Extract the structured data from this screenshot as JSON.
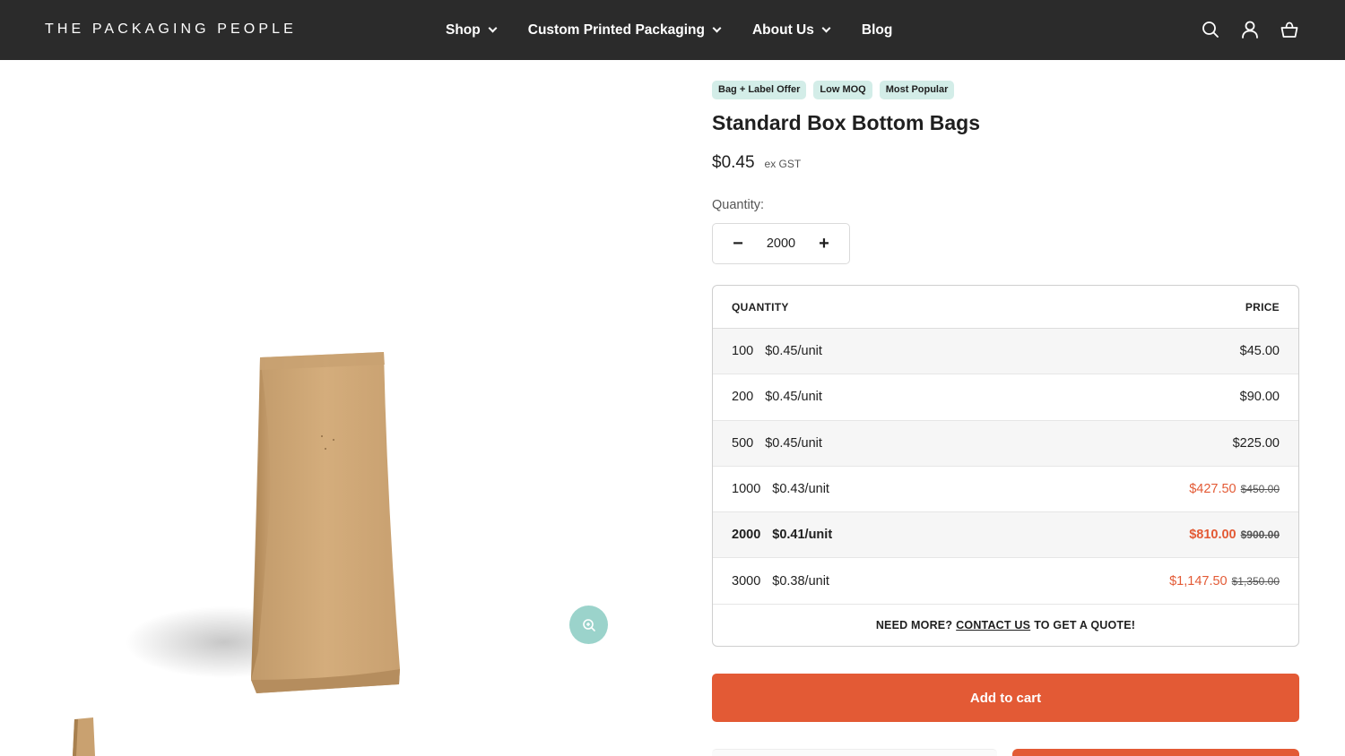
{
  "header": {
    "logo": "THE PACKAGING PEOPLE",
    "nav": [
      {
        "label": "Shop",
        "has_dropdown": true
      },
      {
        "label": "Custom Printed Packaging",
        "has_dropdown": true
      },
      {
        "label": "About Us",
        "has_dropdown": true
      },
      {
        "label": "Blog",
        "has_dropdown": false
      }
    ],
    "icons": [
      "search-icon",
      "account-icon",
      "cart-icon"
    ],
    "background": "#2b2b2b"
  },
  "product": {
    "badges": [
      "Bag + Label Offer",
      "Low MOQ",
      "Most Popular"
    ],
    "title": "Standard Box Bottom Bags",
    "price": "$0.45",
    "price_note": "ex GST",
    "quantity_label": "Quantity:",
    "quantity_value": "2000",
    "decrement": "−",
    "increment": "+"
  },
  "pricing_table": {
    "headers": {
      "quantity": "QUANTITY",
      "price": "PRICE"
    },
    "rows": [
      {
        "qty": "100",
        "unit": "$0.45/unit",
        "price": "$45.00",
        "old_price": ""
      },
      {
        "qty": "200",
        "unit": "$0.45/unit",
        "price": "$90.00",
        "old_price": ""
      },
      {
        "qty": "500",
        "unit": "$0.45/unit",
        "price": "$225.00",
        "old_price": ""
      },
      {
        "qty": "1000",
        "unit": "$0.43/unit",
        "price": "$427.50",
        "old_price": "$450.00"
      },
      {
        "qty": "2000",
        "unit": "$0.41/unit",
        "price": "$810.00",
        "old_price": "$900.00"
      },
      {
        "qty": "3000",
        "unit": "$0.38/unit",
        "price": "$1,147.50",
        "old_price": "$1,350.00"
      }
    ],
    "footer": {
      "before": "NEED MORE?",
      "link": "CONTACT US",
      "after": "TO GET A QUOTE!"
    }
  },
  "actions": {
    "add_to_cart": "Add to cart"
  },
  "colors": {
    "accent": "#e35a35",
    "badge_bg": "#d3ede8",
    "zoom_bg": "#9bd3cb"
  }
}
